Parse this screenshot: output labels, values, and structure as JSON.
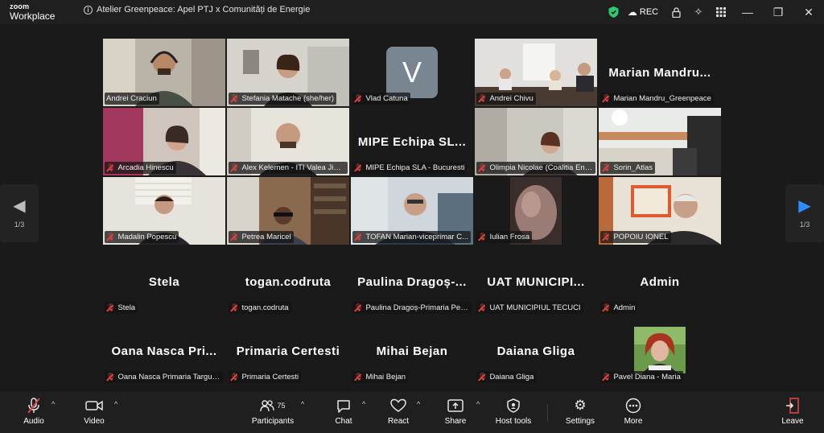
{
  "app": {
    "brand_top": "zoom",
    "brand_bottom": "Workplace",
    "meeting_title": "Atelier Greenpeace: Apel PTJ x Comunități de Energie",
    "recording_label": "REC"
  },
  "pager": {
    "left": "1/3",
    "right": "1/3"
  },
  "tiles": [
    {
      "label": "Andrei Craciun",
      "kind": "video"
    },
    {
      "label": "Stefania Matache (she/her)",
      "kind": "video"
    },
    {
      "label": "Vlad Catuna",
      "kind": "avatar",
      "initial": "V"
    },
    {
      "label": "Andrei Chivu",
      "kind": "video"
    },
    {
      "label": "Marian Mandru_Greenpeace",
      "kind": "name",
      "display": "Marian  Mandru..."
    },
    {
      "label": "Arcadia Hinescu",
      "kind": "video"
    },
    {
      "label": "Alex Kelemen - ITI Valea Jiului",
      "kind": "video"
    },
    {
      "label": "MIPE Echipa SLA - Bucuresti",
      "kind": "name",
      "display": "MIPE  Echipa  SL..."
    },
    {
      "label": "Olimpia Nicolae (Coalitia Energie)",
      "kind": "video"
    },
    {
      "label": "Sorin_Atlas",
      "kind": "video"
    },
    {
      "label": "Madalin Popescu",
      "kind": "video"
    },
    {
      "label": "Petrea Maricel",
      "kind": "video"
    },
    {
      "label": "TOFAN Marian-viceprimar C...",
      "kind": "video"
    },
    {
      "label": "Iulian Frosa",
      "kind": "video"
    },
    {
      "label": "POPOIU IONEL",
      "kind": "video"
    },
    {
      "label": "Stela",
      "kind": "name",
      "display": "Stela"
    },
    {
      "label": "togan.codruta",
      "kind": "name",
      "display": "togan.codruta"
    },
    {
      "label": "Paulina Dragoș-Primaria Petrila",
      "kind": "name",
      "display": "Paulina  Dragoș-..."
    },
    {
      "label": "UAT MUNICIPIUL TECUCI",
      "kind": "name",
      "display": "UAT  MUNICIPI..."
    },
    {
      "label": "Admin",
      "kind": "name",
      "display": "Admin"
    },
    {
      "label": "Oana Nasca Primaria Targu Jiu",
      "kind": "name",
      "display": "Oana  Nasca  Pri..."
    },
    {
      "label": "Primaria Certesti",
      "kind": "name",
      "display": "Primaria  Certesti"
    },
    {
      "label": "Mihai Bejan",
      "kind": "name",
      "display": "Mihai  Bejan"
    },
    {
      "label": "Daiana Gliga",
      "kind": "name",
      "display": "Daiana  Gliga"
    },
    {
      "label": "Pavel Diana - Maria",
      "kind": "photo"
    }
  ],
  "toolbar": {
    "audio": "Audio",
    "video": "Video",
    "participants": "Participants",
    "participants_count": "75",
    "chat": "Chat",
    "react": "React",
    "share": "Share",
    "host_tools": "Host tools",
    "settings": "Settings",
    "more": "More",
    "leave": "Leave"
  },
  "colors": {
    "active_speaker": "#2fd26b",
    "muted": "#e0433e",
    "accent": "#2d8cff"
  }
}
